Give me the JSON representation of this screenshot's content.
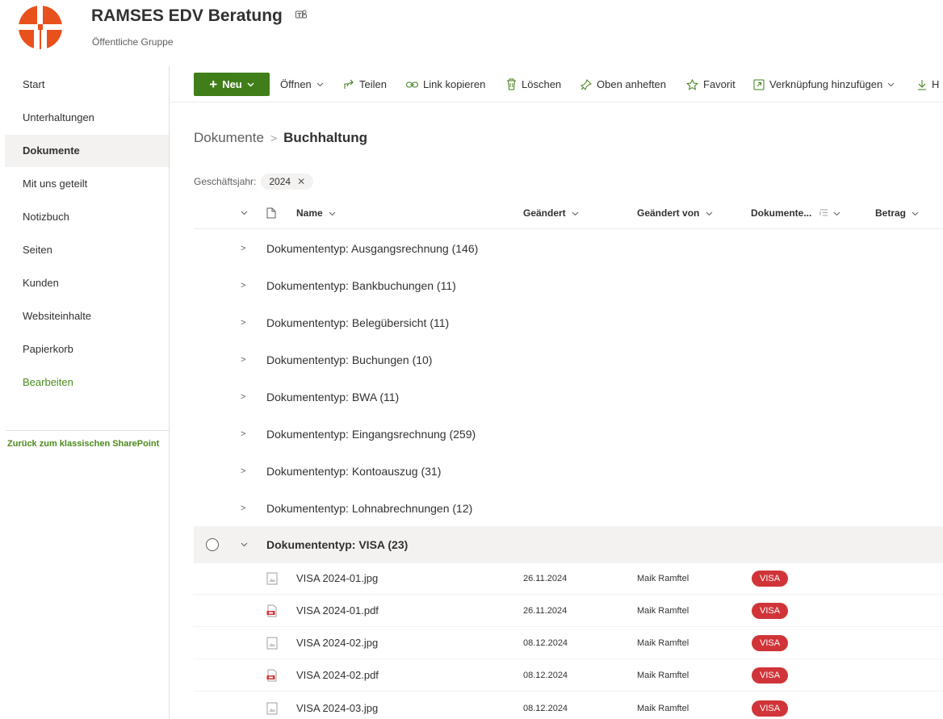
{
  "site": {
    "title": "RAMSES EDV Beratung",
    "subtitle": "Öffentliche Gruppe",
    "brand_color": "#e8501c"
  },
  "nav": {
    "items": [
      {
        "label": "Start"
      },
      {
        "label": "Unterhaltungen"
      },
      {
        "label": "Dokumente",
        "active": true
      },
      {
        "label": "Mit uns geteilt"
      },
      {
        "label": "Notizbuch"
      },
      {
        "label": "Seiten"
      },
      {
        "label": "Kunden"
      },
      {
        "label": "Websiteinhalte"
      },
      {
        "label": "Papierkorb"
      },
      {
        "label": "Bearbeiten"
      }
    ],
    "classic_link": "Zurück zum klassischen SharePoint"
  },
  "commandbar": {
    "new_label": "Neu",
    "open_label": "Öffnen",
    "share_label": "Teilen",
    "copy_link_label": "Link kopieren",
    "delete_label": "Löschen",
    "pin_label": "Oben anheften",
    "favorite_label": "Favorit",
    "add_shortcut_label": "Verknüpfung hinzufügen",
    "download_label": "H"
  },
  "breadcrumb": {
    "root": "Dokumente",
    "current": "Buchhaltung"
  },
  "filter": {
    "label": "Geschäftsjahr:",
    "value": "2024"
  },
  "columns": {
    "name": "Name",
    "modified": "Geändert",
    "modified_by": "Geändert von",
    "doctype": "Dokumente...",
    "amount": "Betrag"
  },
  "groups": [
    {
      "label": "Dokumententyp: Ausgangsrechnung (146)"
    },
    {
      "label": "Dokumententyp: Bankbuchungen (11)"
    },
    {
      "label": "Dokumententyp: Belegübersicht (11)"
    },
    {
      "label": "Dokumententyp: Buchungen (10)"
    },
    {
      "label": "Dokumententyp: BWA (11)"
    },
    {
      "label": "Dokumententyp: Eingangsrechnung (259)"
    },
    {
      "label": "Dokumententyp: Kontoauszug (31)"
    },
    {
      "label": "Dokumententyp: Lohnabrechnungen (12)"
    },
    {
      "label": "Dokumententyp: VISA (23)",
      "expanded": true
    }
  ],
  "files": [
    {
      "name": "VISA 2024-01.jpg",
      "modified": "26.11.2024",
      "modified_by": "Maik Ramftel",
      "doctype": "VISA",
      "icon": "image-file-icon"
    },
    {
      "name": "VISA 2024-01.pdf",
      "modified": "26.11.2024",
      "modified_by": "Maik Ramftel",
      "doctype": "VISA",
      "icon": "pdf-file-icon"
    },
    {
      "name": "VISA 2024-02.jpg",
      "modified": "08.12.2024",
      "modified_by": "Maik Ramftel",
      "doctype": "VISA",
      "icon": "image-file-icon"
    },
    {
      "name": "VISA 2024-02.pdf",
      "modified": "08.12.2024",
      "modified_by": "Maik Ramftel",
      "doctype": "VISA",
      "icon": "pdf-file-icon"
    },
    {
      "name": "VISA 2024-03.jpg",
      "modified": "08.12.2024",
      "modified_by": "Maik Ramftel",
      "doctype": "VISA",
      "icon": "image-file-icon"
    }
  ],
  "colors": {
    "accent_green": "#3f7e19",
    "badge_red": "#d13438",
    "nav_active_bg": "#f3f2f1"
  }
}
